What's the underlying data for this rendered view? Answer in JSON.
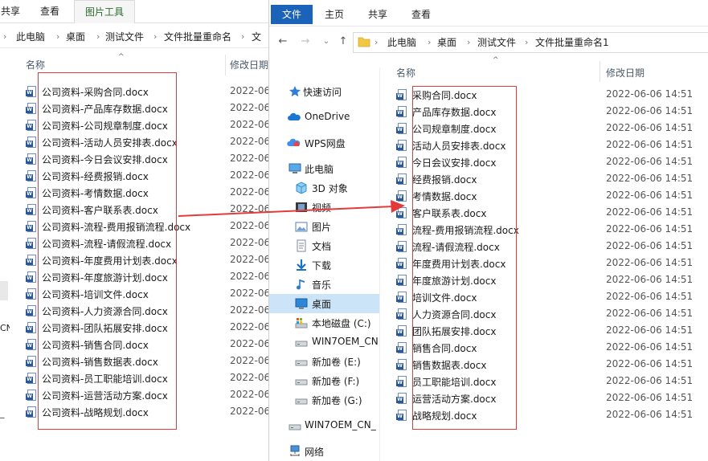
{
  "back_window": {
    "ribbon_tabs": [
      "共享",
      "查看",
      "图片工具"
    ],
    "breadcrumb": [
      "此电脑",
      "桌面",
      "测试文件",
      "文件批量重命名",
      "文"
    ],
    "headers": {
      "name": "名称",
      "date": "修改日期"
    },
    "date_truncated": "2022-06",
    "nav_stubs": [
      "CN",
      "_"
    ],
    "files": [
      "公司资料-采购合同.docx",
      "公司资料-产品库存数据.docx",
      "公司资料-公司规章制度.docx",
      "公司资料-活动人员安排表.docx",
      "公司资料-今日会议安排.docx",
      "公司资料-经费报销.docx",
      "公司资料-考情数据.docx",
      "公司资料-客户联系表.docx",
      "公司资料-流程-费用报销流程.docx",
      "公司资料-流程-请假流程.docx",
      "公司资料-年度费用计划表.docx",
      "公司资料-年度旅游计划.docx",
      "公司资料-培训文件.docx",
      "公司资料-人力资源合同.docx",
      "公司资料-团队拓展安排.docx",
      "公司资料-销售合同.docx",
      "公司资料-销售数据表.docx",
      "公司资料-员工职能培训.docx",
      "公司资料-运营活动方案.docx",
      "公司资料-战略规划.docx"
    ]
  },
  "front_window": {
    "ribbon_tabs": [
      "文件",
      "主页",
      "共享",
      "查看"
    ],
    "breadcrumb": [
      "此电脑",
      "桌面",
      "测试文件",
      "文件批量重命名1"
    ],
    "headers": {
      "name": "名称",
      "date": "修改日期"
    },
    "nav": [
      {
        "label": "快速访问",
        "icon": "star-icon"
      },
      {
        "label": "OneDrive",
        "icon": "cloud-icon"
      },
      {
        "label": "WPS网盘",
        "icon": "wps-cloud-icon"
      },
      {
        "label": "此电脑",
        "icon": "computer-icon"
      },
      {
        "label": "3D 对象",
        "icon": "cube-icon"
      },
      {
        "label": "视频",
        "icon": "film-icon"
      },
      {
        "label": "图片",
        "icon": "picture-icon"
      },
      {
        "label": "文档",
        "icon": "document-icon"
      },
      {
        "label": "下载",
        "icon": "download-icon"
      },
      {
        "label": "音乐",
        "icon": "music-icon"
      },
      {
        "label": "桌面",
        "icon": "desktop-icon"
      },
      {
        "label": "本地磁盘 (C:)",
        "icon": "system-drive-icon"
      },
      {
        "label": "WIN7OEM_CN",
        "icon": "drive-icon"
      },
      {
        "label": "新加卷 (E:)",
        "icon": "drive-icon"
      },
      {
        "label": "新加卷 (F:)",
        "icon": "drive-icon"
      },
      {
        "label": "新加卷 (G:)",
        "icon": "drive-icon"
      },
      {
        "label": "WIN7OEM_CN_",
        "icon": "drive-icon"
      },
      {
        "label": "网络",
        "icon": "network-icon"
      }
    ],
    "selected_nav": "桌面",
    "files": [
      {
        "name": "采购合同.docx",
        "date": "2022-06-06 14:51"
      },
      {
        "name": "产品库存数据.docx",
        "date": "2022-06-06 14:51"
      },
      {
        "name": "公司规章制度.docx",
        "date": "2022-06-06 14:51"
      },
      {
        "name": "活动人员安排表.docx",
        "date": "2022-06-06 14:51"
      },
      {
        "name": "今日会议安排.docx",
        "date": "2022-06-06 14:51"
      },
      {
        "name": "经费报销.docx",
        "date": "2022-06-06 14:51"
      },
      {
        "name": "考情数据.docx",
        "date": "2022-06-06 14:51"
      },
      {
        "name": "客户联系表.docx",
        "date": "2022-06-06 14:51"
      },
      {
        "name": "流程-费用报销流程.docx",
        "date": "2022-06-06 14:51"
      },
      {
        "name": "流程-请假流程.docx",
        "date": "2022-06-06 14:51"
      },
      {
        "name": "年度费用计划表.docx",
        "date": "2022-06-06 14:51"
      },
      {
        "name": "年度旅游计划.docx",
        "date": "2022-06-06 14:51"
      },
      {
        "name": "培训文件.docx",
        "date": "2022-06-06 14:51"
      },
      {
        "name": "人力资源合同.docx",
        "date": "2022-06-06 14:51"
      },
      {
        "name": "团队拓展安排.docx",
        "date": "2022-06-06 14:51"
      },
      {
        "name": "销售合同.docx",
        "date": "2022-06-06 14:51"
      },
      {
        "name": "销售数据表.docx",
        "date": "2022-06-06 14:51"
      },
      {
        "name": "员工职能培训.docx",
        "date": "2022-06-06 14:51"
      },
      {
        "name": "运营活动方案.docx",
        "date": "2022-06-06 14:51"
      },
      {
        "name": "战略规划.docx",
        "date": "2022-06-06 14:51"
      }
    ]
  },
  "colors": {
    "accent": "#1a63b8",
    "annotation_red": "#e23b3b",
    "nav_selected": "#cce4f7"
  }
}
